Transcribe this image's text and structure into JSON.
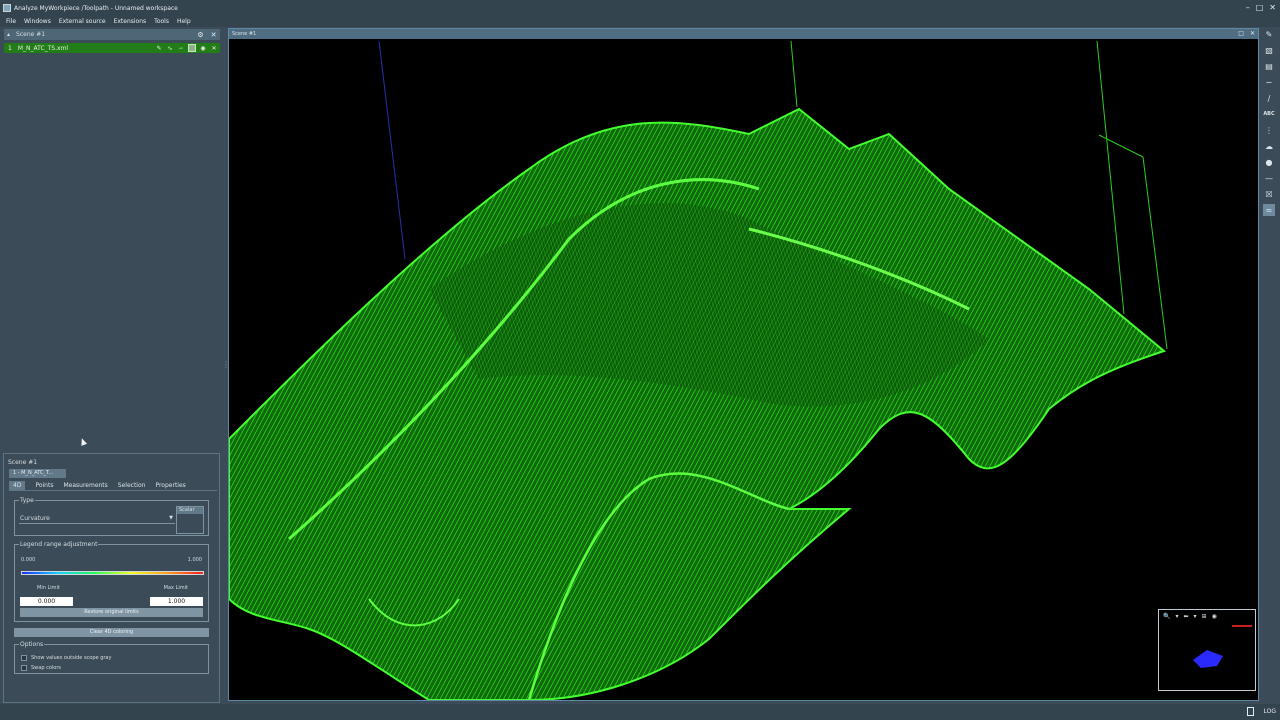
{
  "window": {
    "title": "Analyze MyWorkpiece /Toolpath - Unnamed workspace",
    "controls": [
      "–",
      "□",
      "✕"
    ]
  },
  "menu": [
    "File",
    "Windows",
    "External source",
    "Extensions",
    "Tools",
    "Help"
  ],
  "scene_panel": {
    "header": "Scene #1",
    "files": [
      {
        "index": "1",
        "name": "M_N_ATC_TS.xml"
      }
    ]
  },
  "properties": {
    "title": "Scene #1",
    "object_tab": "1 - M_N_ATC_T...",
    "tabs": [
      "4D",
      "Points",
      "Measurements",
      "Selection",
      "Properties"
    ],
    "active_tab": "4D",
    "type_group": {
      "label": "Type",
      "selected": "Curvature",
      "scalar_label": "Scalar"
    },
    "legend_group": {
      "label": "Legend range adjustment",
      "range_min": "0.000",
      "range_max": "1.000",
      "min_label": "Min Limit",
      "max_label": "Max Limit",
      "min_value": "0.000",
      "max_value": "1.000",
      "restore_button": "Restore original limits"
    },
    "clear_button": "Clear 4D coloring",
    "options_group": {
      "label": "Options",
      "show_gray": "Show values outside scope gray",
      "swap_colors": "Swap colors"
    }
  },
  "viewport": {
    "title": "Scene #1",
    "controls": [
      "□",
      "✕"
    ]
  },
  "minimap": {
    "buttons": [
      "🔍",
      "▾",
      "⬅",
      "▾",
      "⊞",
      "◉"
    ]
  },
  "toolbar": {
    "items": [
      "pen",
      "ruler",
      "chart",
      "curve",
      "line",
      "ABC",
      "more",
      "cloud",
      "sphere",
      "dash",
      "cross",
      "scan"
    ]
  },
  "statusbar": {
    "log_label": "LOG"
  },
  "colors": {
    "mesh_bright": "#33ff22",
    "mesh_mid": "#1fae17",
    "mesh_dark": "#0c5a0a",
    "file_row": "#227d18"
  }
}
